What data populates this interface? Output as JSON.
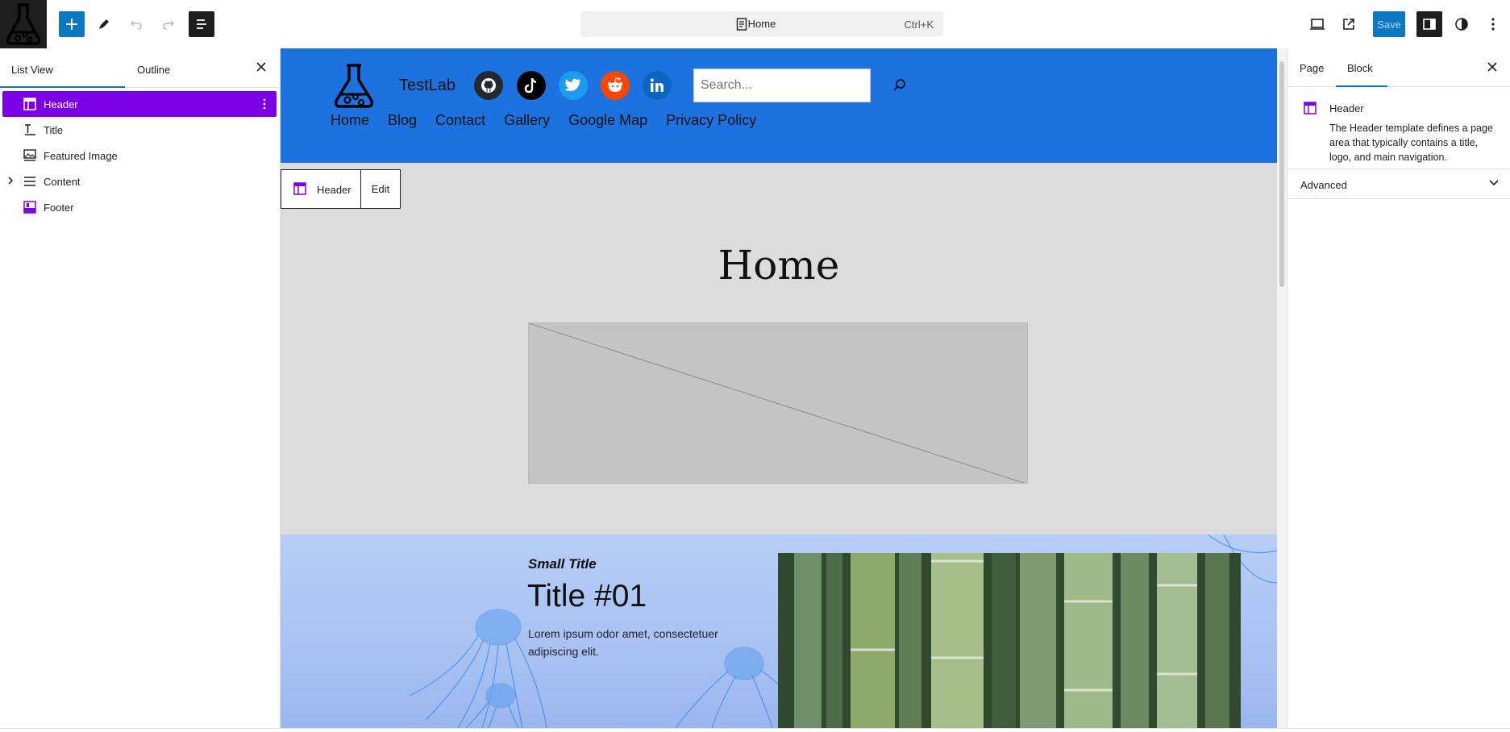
{
  "topbar": {
    "document_title": "Home",
    "shortcut": "Ctrl+K",
    "save_label": "Save"
  },
  "left_panel": {
    "tabs": [
      {
        "label": "List View",
        "active": true
      },
      {
        "label": "Outline",
        "active": false
      }
    ],
    "items": [
      {
        "label": "Header",
        "icon": "template-part-icon",
        "selected": true
      },
      {
        "label": "Title",
        "icon": "title-icon",
        "selected": false
      },
      {
        "label": "Featured Image",
        "icon": "featured-image-icon",
        "selected": false
      },
      {
        "label": "Content",
        "icon": "content-icon",
        "selected": false,
        "expandable": true
      },
      {
        "label": "Footer",
        "icon": "footer-icon",
        "selected": false
      }
    ]
  },
  "canvas": {
    "site_title": "TestLab",
    "search_placeholder": "Search...",
    "social": [
      "github",
      "tiktok",
      "twitter",
      "reddit",
      "linkedin"
    ],
    "nav": [
      "Home",
      "Blog",
      "Contact",
      "Gallery",
      "Google Map",
      "Privacy Policy"
    ],
    "block_toolbar": {
      "block": "Header",
      "edit": "Edit"
    },
    "page_heading": "Home",
    "cover": {
      "small_title": "Small Title",
      "title": "Title #01",
      "text": "Lorem ipsum odor amet, consectetuer adipiscing elit."
    }
  },
  "right_panel": {
    "tabs": [
      {
        "label": "Page",
        "active": false
      },
      {
        "label": "Block",
        "active": true
      }
    ],
    "block_title": "Header",
    "block_description": "The Header template defines a page area that typically contains a title, logo, and main navigation.",
    "advanced_label": "Advanced"
  },
  "colors": {
    "accent": "#0b79c1",
    "selection": "#7c00e6",
    "header_bg": "#1c73e0"
  }
}
